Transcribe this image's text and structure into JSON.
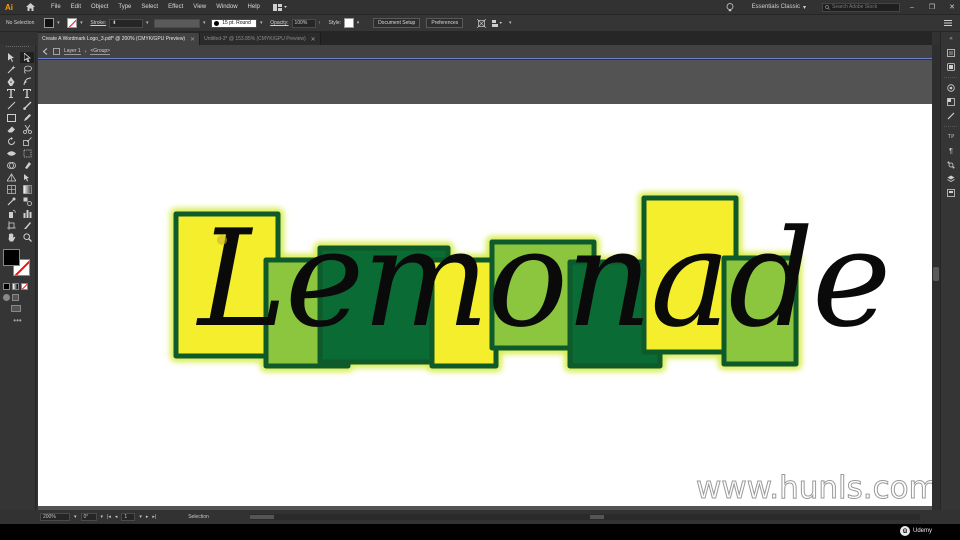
{
  "app": {
    "logo": "Ai",
    "menu": [
      "File",
      "Edit",
      "Object",
      "Type",
      "Select",
      "Effect",
      "View",
      "Window",
      "Help"
    ],
    "workspace": "Essentials Classic",
    "search_placeholder": "Search Adobe Stock"
  },
  "control_bar": {
    "selection_label": "No Selection",
    "stroke_label": "Stroke:",
    "brush_label": "15 pt. Round",
    "opacity_label": "Opacity:",
    "opacity_value": "100%",
    "style_label": "Style:",
    "document_setup": "Document Setup",
    "preferences": "Preferences"
  },
  "tabs": [
    {
      "label": "Create A Wordmark Logo_3.pdf* @ 200% (CMYK/GPU Preview)",
      "active": true
    },
    {
      "label": "Untitled-3* @ 153.85% (CMYK/GPU Preview)",
      "active": false
    }
  ],
  "breadcrumb": {
    "layer": "Layer 1",
    "group": "<Group>"
  },
  "artwork": {
    "word": "Lemonade",
    "colors": {
      "yellow": "#f4ee2c",
      "light_green": "#8cc63f",
      "dark_green": "#0a6b34",
      "outline": "#0f5a2a",
      "glow": "#d4ea3a"
    }
  },
  "status": {
    "zoom": "200%",
    "rotation": "0°",
    "artboard": "1",
    "tool": "Selection"
  },
  "watermark": "www.hunls.com",
  "brand": "Udemy"
}
